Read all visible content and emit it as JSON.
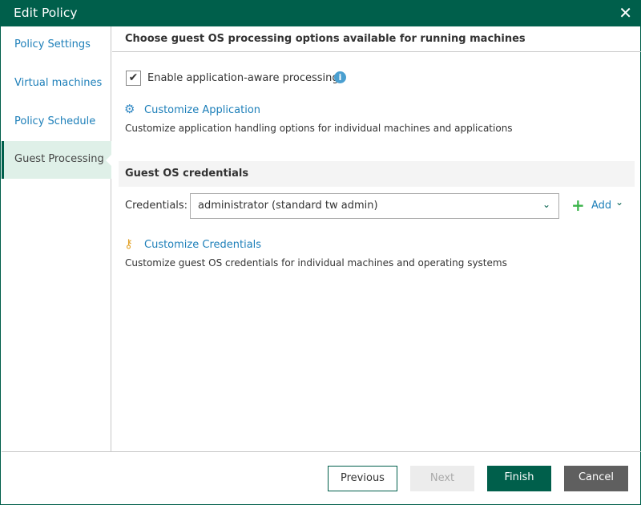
{
  "window": {
    "title": "Edit Policy"
  },
  "sidebar": {
    "items": [
      {
        "label": "Policy Settings"
      },
      {
        "label": "Virtual machines"
      },
      {
        "label": "Policy Schedule"
      },
      {
        "label": "Guest Processing"
      }
    ]
  },
  "main": {
    "header": "Choose guest OS processing options available for running machines",
    "enable_label": "Enable application-aware processing",
    "enable_checked": true,
    "customize_app_label": "Customize Application",
    "customize_app_desc": "Customize application handling options for individual machines and applications",
    "credentials_section": "Guest OS credentials",
    "credentials_label": "Credentials:",
    "credentials_value": "administrator (standard tw admin)",
    "add_label": "Add",
    "customize_creds_label": "Customize Credentials",
    "customize_creds_desc": "Customize guest OS credentials for individual machines and operating systems"
  },
  "footer": {
    "previous": "Previous",
    "next": "Next",
    "finish": "Finish",
    "cancel": "Cancel"
  },
  "colors": {
    "brand": "#005f4b",
    "link": "#1d7fb9",
    "add": "#3cb44b"
  }
}
